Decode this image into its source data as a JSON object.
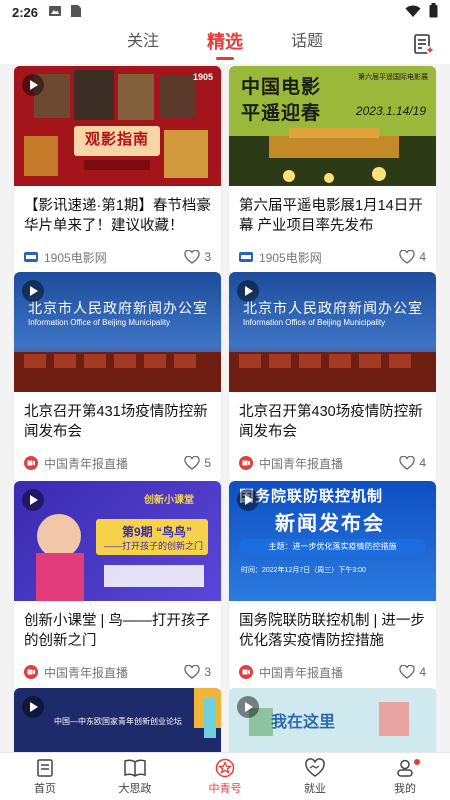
{
  "status_bar": {
    "time": "2:26"
  },
  "top_tabs": [
    {
      "label": "关注"
    },
    {
      "label": "精选"
    },
    {
      "label": "话题"
    }
  ],
  "cards": [
    {
      "thumb_texts": [
        "观影指南",
        "1905"
      ],
      "title": "【影讯速递·第1期】春节档豪华片单来了！建议收藏！",
      "source": "1905电影网",
      "likes": "3"
    },
    {
      "thumb_texts": [
        "中国电影",
        "平遥迎春",
        "第六届平遥国际电影展",
        "2023.1.14/19"
      ],
      "title": "第六届平遥电影展1月14日开幕 产业项目率先发布",
      "source": "1905电影网",
      "likes": "4"
    },
    {
      "thumb_texts": [
        "北京市人民政府新闻办公室",
        "Information Office of Beijing Municipality"
      ],
      "title": "北京召开第431场疫情防控新闻发布会",
      "source": "中国青年报直播",
      "likes": "5"
    },
    {
      "thumb_texts": [
        "北京市人民政府新闻办公室",
        "Information Office of Beijing Municipality"
      ],
      "title": "北京召开第430场疫情防控新闻发布会",
      "source": "中国青年报直播",
      "likes": "4"
    },
    {
      "thumb_texts": [
        "第9期 “鸟鸟”",
        "——打开孩子的创新之门",
        "创新小课堂"
      ],
      "title": "创新小课堂 | 鸟——打开孩子的创新之门",
      "source": "中国青年报直播",
      "likes": "3"
    },
    {
      "thumb_texts": [
        "国务院联防联控机制",
        "新闻发布会",
        "主题：进一步优化落实疫情防控措施",
        "时间：2022年12月7日（周三）下午3:00"
      ],
      "title": "国务院联防联控机制 | 进一步优化落实疫情防控措施",
      "source": "中国青年报直播",
      "likes": "4"
    },
    {
      "thumb_texts": [
        "中国—中东欧国家青年创新创业论坛"
      ],
      "title": "",
      "source": "",
      "likes": ""
    },
    {
      "thumb_texts": [
        "我在这里"
      ],
      "title": "",
      "source": "",
      "likes": ""
    }
  ],
  "bottom_nav": [
    {
      "label": "首页"
    },
    {
      "label": "大思政"
    },
    {
      "label": "中青号"
    },
    {
      "label": "就业"
    },
    {
      "label": "我的"
    }
  ],
  "colors": {
    "accent": "#e43d3d"
  },
  "icons": {
    "image": "image-icon",
    "card": "sim-card-icon",
    "wifi": "wifi-icon",
    "battery": "battery-icon",
    "edit": "edit-list-icon",
    "like": "heart-icon",
    "play": "play-icon"
  }
}
